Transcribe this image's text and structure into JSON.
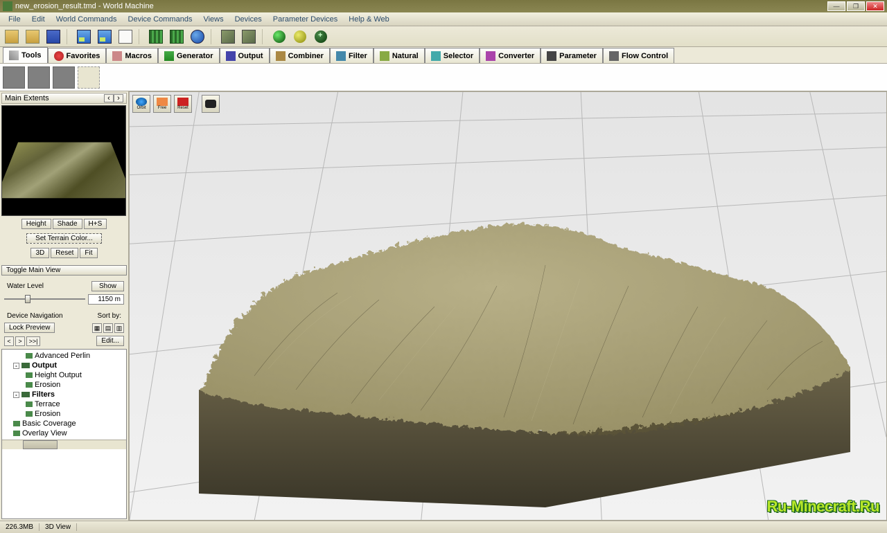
{
  "titlebar": {
    "title": "new_erosion_result.tmd - World Machine"
  },
  "menu": [
    "File",
    "Edit",
    "World Commands",
    "Device Commands",
    "Views",
    "Devices",
    "Parameter Devices",
    "Help & Web"
  ],
  "tabs": [
    {
      "label": "Tools",
      "icon": "tools"
    },
    {
      "label": "Favorites",
      "icon": "fav"
    },
    {
      "label": "Macros",
      "icon": "mac"
    },
    {
      "label": "Generator",
      "icon": "gen"
    },
    {
      "label": "Output",
      "icon": "out"
    },
    {
      "label": "Combiner",
      "icon": "com"
    },
    {
      "label": "Filter",
      "icon": "fil"
    },
    {
      "label": "Natural",
      "icon": "nat"
    },
    {
      "label": "Selector",
      "icon": "sel"
    },
    {
      "label": "Converter",
      "icon": "con"
    },
    {
      "label": "Parameter",
      "icon": "par"
    },
    {
      "label": "Flow Control",
      "icon": "flo"
    }
  ],
  "left": {
    "extents_label": "Main Extents",
    "btn_height": "Height",
    "btn_shade": "Shade",
    "btn_hs": "H+S",
    "btn_terrain_color": "Set Terrain Color...",
    "btn_3d": "3D",
    "btn_reset": "Reset",
    "btn_fit": "Fit",
    "btn_toggle": "Toggle Main View",
    "water_label": "Water Level",
    "btn_show": "Show",
    "water_value": "1150 m",
    "devnav_label": "Device Navigation",
    "sort_label": "Sort by:",
    "btn_lock": "Lock Preview",
    "btn_edit": "Edit...",
    "nav_prev": "<",
    "nav_next": ">",
    "nav_last": ">>|",
    "tree": [
      {
        "level": 2,
        "label": "Advanced Perlin",
        "ico": "n"
      },
      {
        "level": 1,
        "label": "Output",
        "bold": true,
        "exp": "-",
        "ico": "cat"
      },
      {
        "level": 2,
        "label": "Height Output",
        "ico": "n"
      },
      {
        "level": 2,
        "label": "Erosion",
        "ico": "n"
      },
      {
        "level": 1,
        "label": "Filters",
        "bold": true,
        "exp": "-",
        "ico": "cat"
      },
      {
        "level": 2,
        "label": "Terrace",
        "ico": "n"
      },
      {
        "level": 2,
        "label": "Erosion",
        "ico": "n"
      },
      {
        "level": 1,
        "label": "Basic Coverage",
        "ico": "n"
      },
      {
        "level": 1,
        "label": "Overlay View",
        "ico": "n"
      }
    ]
  },
  "viewport": {
    "btn_orbit": "Orbit",
    "btn_free": "Free",
    "btn_reset": "Reset"
  },
  "status": {
    "memory": "226.3MB",
    "view": "3D View"
  },
  "watermark": "Ru-Minecraft.Ru"
}
